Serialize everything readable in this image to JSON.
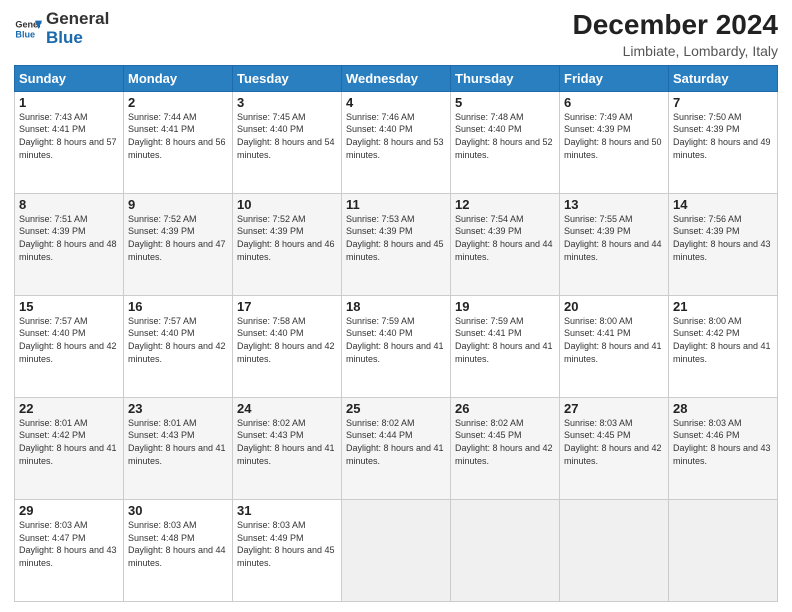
{
  "header": {
    "logo_general": "General",
    "logo_blue": "Blue",
    "title": "December 2024",
    "location": "Limbiate, Lombardy, Italy"
  },
  "days_of_week": [
    "Sunday",
    "Monday",
    "Tuesday",
    "Wednesday",
    "Thursday",
    "Friday",
    "Saturday"
  ],
  "weeks": [
    [
      {
        "day": "1",
        "sunrise": "7:43 AM",
        "sunset": "4:41 PM",
        "daylight": "8 hours and 57 minutes."
      },
      {
        "day": "2",
        "sunrise": "7:44 AM",
        "sunset": "4:41 PM",
        "daylight": "8 hours and 56 minutes."
      },
      {
        "day": "3",
        "sunrise": "7:45 AM",
        "sunset": "4:40 PM",
        "daylight": "8 hours and 54 minutes."
      },
      {
        "day": "4",
        "sunrise": "7:46 AM",
        "sunset": "4:40 PM",
        "daylight": "8 hours and 53 minutes."
      },
      {
        "day": "5",
        "sunrise": "7:48 AM",
        "sunset": "4:40 PM",
        "daylight": "8 hours and 52 minutes."
      },
      {
        "day": "6",
        "sunrise": "7:49 AM",
        "sunset": "4:39 PM",
        "daylight": "8 hours and 50 minutes."
      },
      {
        "day": "7",
        "sunrise": "7:50 AM",
        "sunset": "4:39 PM",
        "daylight": "8 hours and 49 minutes."
      }
    ],
    [
      {
        "day": "8",
        "sunrise": "7:51 AM",
        "sunset": "4:39 PM",
        "daylight": "8 hours and 48 minutes."
      },
      {
        "day": "9",
        "sunrise": "7:52 AM",
        "sunset": "4:39 PM",
        "daylight": "8 hours and 47 minutes."
      },
      {
        "day": "10",
        "sunrise": "7:52 AM",
        "sunset": "4:39 PM",
        "daylight": "8 hours and 46 minutes."
      },
      {
        "day": "11",
        "sunrise": "7:53 AM",
        "sunset": "4:39 PM",
        "daylight": "8 hours and 45 minutes."
      },
      {
        "day": "12",
        "sunrise": "7:54 AM",
        "sunset": "4:39 PM",
        "daylight": "8 hours and 44 minutes."
      },
      {
        "day": "13",
        "sunrise": "7:55 AM",
        "sunset": "4:39 PM",
        "daylight": "8 hours and 44 minutes."
      },
      {
        "day": "14",
        "sunrise": "7:56 AM",
        "sunset": "4:39 PM",
        "daylight": "8 hours and 43 minutes."
      }
    ],
    [
      {
        "day": "15",
        "sunrise": "7:57 AM",
        "sunset": "4:40 PM",
        "daylight": "8 hours and 42 minutes."
      },
      {
        "day": "16",
        "sunrise": "7:57 AM",
        "sunset": "4:40 PM",
        "daylight": "8 hours and 42 minutes."
      },
      {
        "day": "17",
        "sunrise": "7:58 AM",
        "sunset": "4:40 PM",
        "daylight": "8 hours and 42 minutes."
      },
      {
        "day": "18",
        "sunrise": "7:59 AM",
        "sunset": "4:40 PM",
        "daylight": "8 hours and 41 minutes."
      },
      {
        "day": "19",
        "sunrise": "7:59 AM",
        "sunset": "4:41 PM",
        "daylight": "8 hours and 41 minutes."
      },
      {
        "day": "20",
        "sunrise": "8:00 AM",
        "sunset": "4:41 PM",
        "daylight": "8 hours and 41 minutes."
      },
      {
        "day": "21",
        "sunrise": "8:00 AM",
        "sunset": "4:42 PM",
        "daylight": "8 hours and 41 minutes."
      }
    ],
    [
      {
        "day": "22",
        "sunrise": "8:01 AM",
        "sunset": "4:42 PM",
        "daylight": "8 hours and 41 minutes."
      },
      {
        "day": "23",
        "sunrise": "8:01 AM",
        "sunset": "4:43 PM",
        "daylight": "8 hours and 41 minutes."
      },
      {
        "day": "24",
        "sunrise": "8:02 AM",
        "sunset": "4:43 PM",
        "daylight": "8 hours and 41 minutes."
      },
      {
        "day": "25",
        "sunrise": "8:02 AM",
        "sunset": "4:44 PM",
        "daylight": "8 hours and 41 minutes."
      },
      {
        "day": "26",
        "sunrise": "8:02 AM",
        "sunset": "4:45 PM",
        "daylight": "8 hours and 42 minutes."
      },
      {
        "day": "27",
        "sunrise": "8:03 AM",
        "sunset": "4:45 PM",
        "daylight": "8 hours and 42 minutes."
      },
      {
        "day": "28",
        "sunrise": "8:03 AM",
        "sunset": "4:46 PM",
        "daylight": "8 hours and 43 minutes."
      }
    ],
    [
      {
        "day": "29",
        "sunrise": "8:03 AM",
        "sunset": "4:47 PM",
        "daylight": "8 hours and 43 minutes."
      },
      {
        "day": "30",
        "sunrise": "8:03 AM",
        "sunset": "4:48 PM",
        "daylight": "8 hours and 44 minutes."
      },
      {
        "day": "31",
        "sunrise": "8:03 AM",
        "sunset": "4:49 PM",
        "daylight": "8 hours and 45 minutes."
      },
      null,
      null,
      null,
      null
    ]
  ],
  "labels": {
    "sunrise": "Sunrise:",
    "sunset": "Sunset:",
    "daylight": "Daylight:"
  }
}
